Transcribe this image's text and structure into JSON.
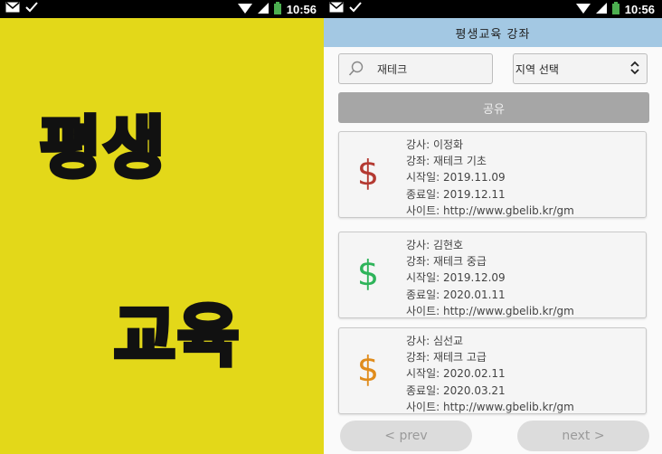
{
  "status_bar": {
    "time": "10:56"
  },
  "splash": {
    "line1": "평생",
    "line2": "교육"
  },
  "app": {
    "title": "평생교육 강좌",
    "search": {
      "value": "재테크"
    },
    "region_select": {
      "selected": "지역 선택"
    },
    "share_label": "공유",
    "courses": [
      {
        "icon": "dollar-icon",
        "color": "#b43a32",
        "lines": [
          "강사: 이정화",
          "강좌: 재테크 기초",
          "시작일: 2019.11.09",
          "종료일: 2019.12.11",
          "사이트: http://www.gbelib.kr/gm"
        ]
      },
      {
        "icon": "dollar-icon",
        "color": "#2eb45a",
        "lines": [
          "강사: 김현호",
          "강좌: 재테크 중급",
          "시작일: 2019.12.09",
          "종료일: 2020.01.11",
          "사이트: http://www.gbelib.kr/gm"
        ]
      },
      {
        "icon": "dollar-icon",
        "color": "#e08c1c",
        "lines": [
          "강사: 심선교",
          "강좌: 재테크 고급",
          "시작일: 2020.02.11",
          "종료일: 2020.03.21",
          "사이트: http://www.gbelib.kr/gm"
        ]
      }
    ],
    "pager": {
      "prev": "< prev",
      "next": "next >"
    }
  }
}
